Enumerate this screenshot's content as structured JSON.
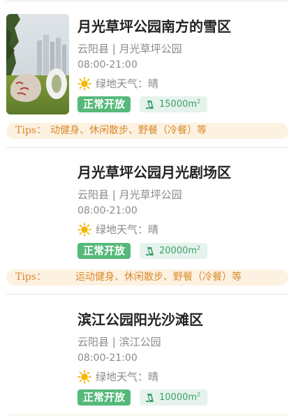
{
  "parks": [
    {
      "title": "月光草坪公园南方的雪区",
      "location": "云阳县 | 月光草坪公园",
      "hours": "08:00-21:00",
      "weather_label": "绿地天气：",
      "weather_value": "晴",
      "weather_icon": "sun-icon",
      "status": "正常开放",
      "area_value": "15000",
      "area_unit": "m",
      "area_sup": "2",
      "tips_label": "Tips：",
      "tips_text": "动健身、休闲散步、野餐（冷餐）等",
      "has_image": true
    },
    {
      "title": "月光草坪公园月光剧场区",
      "location": "云阳县 | 月光草坪公园",
      "hours": "08:00-21:00",
      "weather_label": "绿地天气：",
      "weather_value": "晴",
      "weather_icon": "sun-icon",
      "status": "正常开放",
      "area_value": "20000",
      "area_unit": "m",
      "area_sup": "2",
      "tips_label": "Tips：",
      "tips_text": "运动健身、休闲散步、野餐（冷餐）等",
      "has_image": false
    },
    {
      "title": "滨江公园阳光沙滩区",
      "location": "云阳县 | 滨江公园",
      "hours": "08:00-21:00",
      "weather_label": "绿地天气：",
      "weather_value": "晴",
      "weather_icon": "sun-icon",
      "status": "正常开放",
      "area_value": "10000",
      "area_unit": "m",
      "area_sup": "2",
      "has_image": false
    }
  ],
  "colors": {
    "status_green": "#55b97a",
    "area_bg": "#e5f3ec",
    "tips_bg": "#fdf1e1",
    "tips_text": "#d88a2b"
  }
}
